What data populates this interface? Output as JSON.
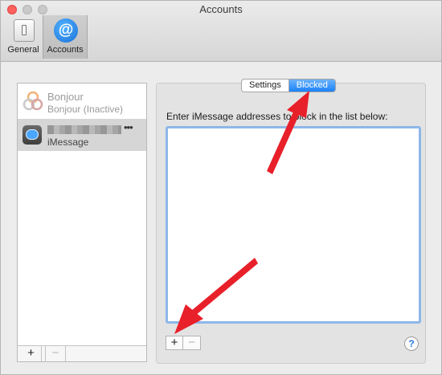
{
  "window": {
    "title": "Accounts"
  },
  "toolbar": {
    "items": [
      {
        "label": "General",
        "icon": "switch-icon",
        "selected": false
      },
      {
        "label": "Accounts",
        "icon": "at-sign-icon",
        "selected": true
      }
    ]
  },
  "sidebar": {
    "accounts": [
      {
        "name": "Bonjour",
        "status": "Bonjour (Inactive)",
        "icon": "bonjour-icon",
        "selected": false
      },
      {
        "name": "•••",
        "status": "iMessage",
        "icon": "imessage-icon",
        "selected": true
      }
    ],
    "add_label": "+",
    "remove_label": "−"
  },
  "tabs": {
    "settings": "Settings",
    "blocked": "Blocked",
    "active": "Blocked"
  },
  "blocked": {
    "instruction": "Enter iMessage addresses to block in the list below:",
    "entries": [],
    "add_label": "+",
    "remove_label": "−"
  },
  "help_label": "?",
  "colors": {
    "accent": "#1a82fb",
    "annotation_arrow": "#e8202a"
  }
}
